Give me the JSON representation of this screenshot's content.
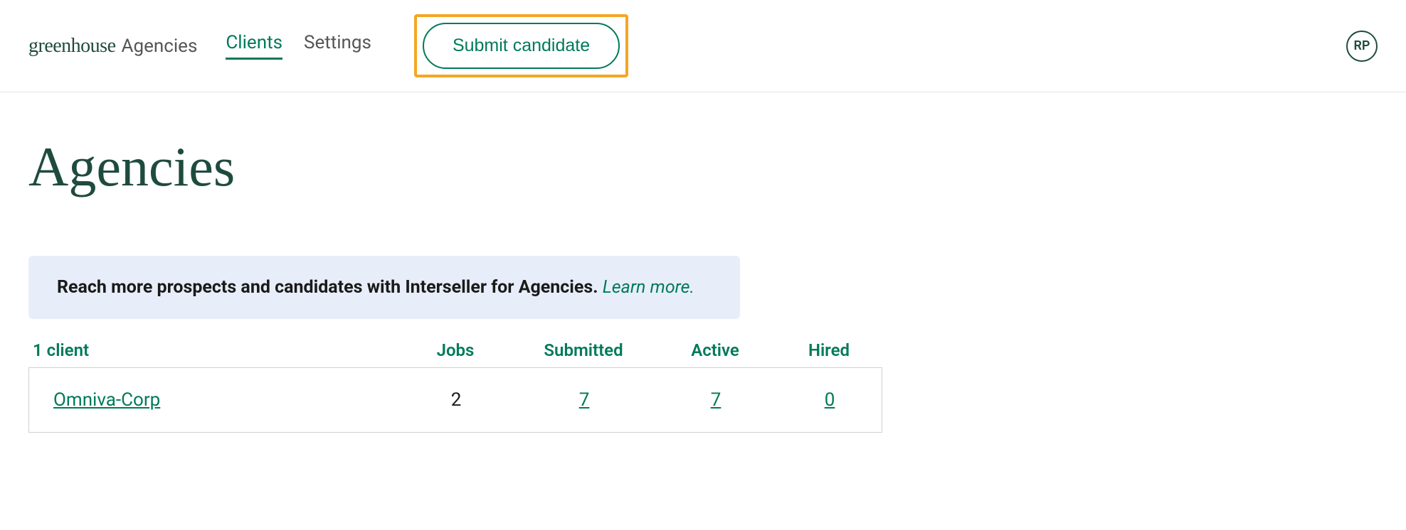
{
  "header": {
    "brand": "greenhouse",
    "suffix": "Agencies",
    "nav": {
      "clients": "Clients",
      "settings": "Settings"
    },
    "submit_label": "Submit candidate",
    "avatar_initials": "RP"
  },
  "page": {
    "title": "Agencies"
  },
  "banner": {
    "text": "Reach more prospects and candidates with Interseller for Agencies.",
    "link_text": "Learn more."
  },
  "table": {
    "count_label": "1 client",
    "headers": {
      "jobs": "Jobs",
      "submitted": "Submitted",
      "active": "Active",
      "hired": "Hired"
    },
    "rows": [
      {
        "name": "Omniva-Corp",
        "jobs": "2",
        "submitted": "7",
        "active": "7",
        "hired": "0"
      }
    ]
  }
}
